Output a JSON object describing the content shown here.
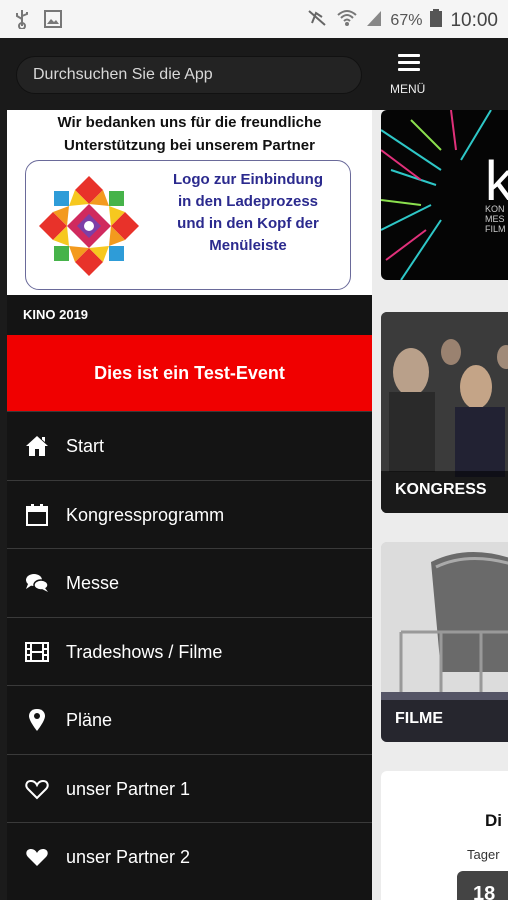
{
  "status_bar": {
    "battery": "67%",
    "time": "10:00",
    "icons": [
      "usb-icon",
      "image-icon",
      "mute-icon",
      "wifi-icon",
      "signal-icon",
      "battery-icon"
    ]
  },
  "header": {
    "search_placeholder": "Durchsuchen Sie die App",
    "menu_label": "MENÜ"
  },
  "partner_banner": {
    "line1": "Wir bedanken uns für die freundliche",
    "line2": "Unterstützung bei unserem Partner",
    "logo_text": [
      "Logo zur Einbindung",
      "in den Ladeprozess",
      "und in den Kopf der",
      "Menüleiste"
    ]
  },
  "drawer": {
    "event_title": "KINO 2019",
    "test_event_label": "Dies ist ein Test-Event",
    "test_event_color": "#f00000",
    "items": [
      {
        "label": "Start",
        "icon": "home-icon"
      },
      {
        "label": "Kongressprogramm",
        "icon": "calendar-icon"
      },
      {
        "label": "Messe",
        "icon": "chat-icon"
      },
      {
        "label": "Tradeshows / Filme",
        "icon": "film-icon"
      },
      {
        "label": "Pläne",
        "icon": "map-marker-icon"
      },
      {
        "label": "unser Partner 1",
        "icon": "heart-outline-icon"
      },
      {
        "label": "unser Partner 2",
        "icon": "heart-icon"
      }
    ]
  },
  "content": {
    "cards": [
      {
        "label": ""
      },
      {
        "label": "KONGRESS"
      },
      {
        "label": "FILME"
      }
    ],
    "card4": {
      "title": "Di",
      "sub": "Tager",
      "counter": "18"
    }
  }
}
